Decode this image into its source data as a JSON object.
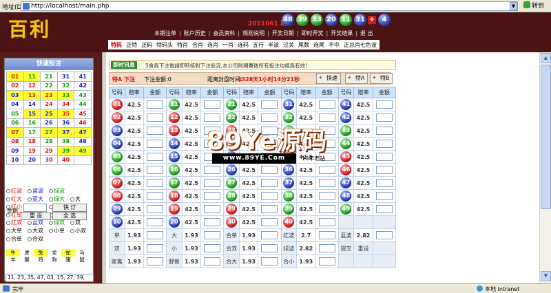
{
  "browser": {
    "address_label": "地址(D)",
    "url": "http://localhost/main.php",
    "dropdown_glyph": "▼",
    "go_label": "转到"
  },
  "header": {
    "logo": "百利",
    "period": "2011061 期",
    "balls": [
      {
        "n": "48",
        "color": "blue"
      },
      {
        "n": "39",
        "color": "green"
      },
      {
        "n": "33",
        "color": "green"
      },
      {
        "n": "20",
        "color": "blue"
      },
      {
        "n": "11",
        "color": "green"
      },
      {
        "n": "31",
        "color": "blue"
      }
    ],
    "plus": "+",
    "special": {
      "n": "4",
      "color": "blue"
    },
    "topnav": [
      "本期注单",
      "账户历史",
      "会员资料",
      "规则说明",
      "开奖日期",
      "即时开奖",
      "开奖结果",
      "退 出"
    ],
    "tabs": [
      "特码",
      "正特",
      "正码",
      "特码头",
      "特肖",
      "合肖",
      "连肖",
      "一肖",
      "连码",
      "五行",
      "半波",
      "过关",
      "尾数",
      "连尾",
      "不中",
      "正总肖七色波"
    ],
    "active_tab": 0
  },
  "left": {
    "title": "快速投注",
    "numbers": [
      [
        {
          "n": "01",
          "c": "r",
          "y": true
        },
        {
          "n": "11",
          "c": "g",
          "y": true
        },
        {
          "n": "21",
          "c": "g"
        },
        {
          "n": "31",
          "c": "b"
        },
        {
          "n": "41",
          "c": "b"
        }
      ],
      [
        {
          "n": "02",
          "c": "r"
        },
        {
          "n": "12",
          "c": "r"
        },
        {
          "n": "22",
          "c": "g"
        },
        {
          "n": "32",
          "c": "g"
        },
        {
          "n": "42",
          "c": "b"
        }
      ],
      [
        {
          "n": "03",
          "c": "b",
          "y": true
        },
        {
          "n": "13",
          "c": "r",
          "y": true
        },
        {
          "n": "23",
          "c": "r",
          "y": true
        },
        {
          "n": "33",
          "c": "g",
          "y": true
        },
        {
          "n": "43",
          "c": "g"
        }
      ],
      [
        {
          "n": "04",
          "c": "b"
        },
        {
          "n": "14",
          "c": "b"
        },
        {
          "n": "24",
          "c": "r"
        },
        {
          "n": "34",
          "c": "r"
        },
        {
          "n": "44",
          "c": "g"
        }
      ],
      [
        {
          "n": "05",
          "c": "g"
        },
        {
          "n": "15",
          "c": "b",
          "y": true
        },
        {
          "n": "25",
          "c": "b",
          "y": true
        },
        {
          "n": "35",
          "c": "r",
          "y": true
        },
        {
          "n": "45",
          "c": "r"
        }
      ],
      [
        {
          "n": "06",
          "c": "g"
        },
        {
          "n": "16",
          "c": "g"
        },
        {
          "n": "26",
          "c": "b"
        },
        {
          "n": "36",
          "c": "b"
        },
        {
          "n": "46",
          "c": "r"
        }
      ],
      [
        {
          "n": "07",
          "c": "r",
          "y": true
        },
        {
          "n": "17",
          "c": "g"
        },
        {
          "n": "27",
          "c": "g",
          "y": true
        },
        {
          "n": "37",
          "c": "b",
          "y": true
        },
        {
          "n": "47",
          "c": "b",
          "y": true
        }
      ],
      [
        {
          "n": "08",
          "c": "r"
        },
        {
          "n": "18",
          "c": "r"
        },
        {
          "n": "28",
          "c": "g"
        },
        {
          "n": "38",
          "c": "g"
        },
        {
          "n": "48",
          "c": "b"
        }
      ],
      [
        {
          "n": "09",
          "c": "b"
        },
        {
          "n": "19",
          "c": "r"
        },
        {
          "n": "29",
          "c": "r"
        },
        {
          "n": "39",
          "c": "g",
          "y": true
        },
        {
          "n": "49",
          "c": "g",
          "y": true
        }
      ],
      [
        {
          "n": "10",
          "c": "b"
        },
        {
          "n": "20",
          "c": "b"
        },
        {
          "n": "30",
          "c": "r"
        },
        {
          "n": "40",
          "c": "r"
        },
        {
          "n": "",
          "c": "b"
        }
      ]
    ],
    "options": [
      [
        "红波",
        "蓝波",
        "绿波"
      ],
      [
        "红大",
        "蓝大",
        "绿大",
        "大"
      ],
      [
        "红小",
        "蓝小",
        "绿小",
        "小"
      ],
      [
        "红单",
        "蓝单",
        "绿单",
        "单"
      ],
      [
        "红双",
        "蓝双",
        "绿双",
        "双"
      ],
      [
        "大单",
        "大双",
        "小单",
        "小双"
      ],
      [
        "合单",
        "合双"
      ]
    ],
    "zodiac_row1": [
      {
        "t": "牛",
        "y": true
      },
      {
        "t": "虎",
        "y": false
      },
      {
        "t": "兔",
        "y": true
      },
      {
        "t": "龙",
        "y": false
      },
      {
        "t": "蛇",
        "y": true
      },
      {
        "t": "马",
        "y": false
      }
    ],
    "zodiac_row2": [
      {
        "t": "羊",
        "y": false
      },
      {
        "t": "猴",
        "y": false
      },
      {
        "t": "鸡",
        "y": false
      },
      {
        "t": "狗",
        "y": false
      },
      {
        "t": "猪",
        "y": false
      },
      {
        "t": "鼠",
        "y": false
      }
    ],
    "amount_label": "金额",
    "btn_quick": "快 订",
    "btn_reset": "重 设",
    "btn_all": "全 选",
    "selected": "11, 23, 35, 47, 03, 15, 27, 39,"
  },
  "main": {
    "notice_label": "即时讯息",
    "notice_text": "5會員下注後請即時核對下注狀況,本公司則開賽後所有投注均視爲有效!",
    "bet_type": "特A 下注",
    "bet_total": "下注金额:0",
    "close_label": "距离封盘时间:",
    "close_time": "4328天1小时14分21秒",
    "btn_quick": "快速",
    "btn_a": "特A",
    "btn_b": "特B",
    "headers": [
      "号码",
      "赔率",
      "金额",
      "号码",
      "赔率",
      "金额",
      "号码",
      "赔率",
      "金额",
      "号码",
      "赔率",
      "金额",
      "号码",
      "赔率",
      "金额"
    ],
    "odds": "42.5",
    "rows": [
      [
        {
          "n": "01",
          "c": "red"
        },
        {
          "n": "11",
          "c": "green"
        },
        {
          "n": "21",
          "c": "green"
        },
        {
          "n": "31",
          "c": "blue"
        },
        {
          "n": "41",
          "c": "blue"
        }
      ],
      [
        {
          "n": "02",
          "c": "red"
        },
        {
          "n": "12",
          "c": "red"
        },
        {
          "n": "22",
          "c": "green"
        },
        {
          "n": "32",
          "c": "green"
        },
        {
          "n": "42",
          "c": "blue"
        }
      ],
      [
        {
          "n": "03",
          "c": "blue"
        },
        {
          "n": "13",
          "c": "red"
        },
        {
          "n": "23",
          "c": "red"
        },
        {
          "n": "33",
          "c": "green"
        },
        {
          "n": "43",
          "c": "green"
        }
      ],
      [
        {
          "n": "04",
          "c": "blue"
        },
        {
          "n": "14",
          "c": "blue"
        },
        {
          "n": "24",
          "c": "red"
        },
        {
          "n": "34",
          "c": "red"
        },
        {
          "n": "44",
          "c": "green"
        }
      ],
      [
        {
          "n": "05",
          "c": "green"
        },
        {
          "n": "15",
          "c": "blue"
        },
        {
          "n": "25",
          "c": "blue"
        },
        {
          "n": "35",
          "c": "red"
        },
        {
          "n": "45",
          "c": "red"
        }
      ],
      [
        {
          "n": "06",
          "c": "green"
        },
        {
          "n": "16",
          "c": "green"
        },
        {
          "n": "26",
          "c": "blue"
        },
        {
          "n": "36",
          "c": "blue"
        },
        {
          "n": "46",
          "c": "red"
        }
      ],
      [
        {
          "n": "07",
          "c": "red"
        },
        {
          "n": "17",
          "c": "green"
        },
        {
          "n": "27",
          "c": "green"
        },
        {
          "n": "37",
          "c": "blue"
        },
        {
          "n": "47",
          "c": "blue"
        }
      ],
      [
        {
          "n": "08",
          "c": "red"
        },
        {
          "n": "18",
          "c": "red"
        },
        {
          "n": "28",
          "c": "green"
        },
        {
          "n": "38",
          "c": "green"
        },
        {
          "n": "48",
          "c": "blue"
        }
      ],
      [
        {
          "n": "09",
          "c": "blue"
        },
        {
          "n": "19",
          "c": "red"
        },
        {
          "n": "29",
          "c": "red"
        },
        {
          "n": "39",
          "c": "green"
        },
        {
          "n": "49",
          "c": "green"
        }
      ],
      [
        {
          "n": "10",
          "c": "blue"
        },
        {
          "n": "20",
          "c": "blue"
        },
        {
          "n": "30",
          "c": "red"
        },
        {
          "n": "40",
          "c": "red"
        }
      ]
    ],
    "bottom_rows": [
      [
        {
          "l": "单",
          "v": "1.93"
        },
        {
          "l": "大",
          "v": "1.93"
        },
        {
          "l": "合单",
          "v": "1.93"
        },
        {
          "l": "红波",
          "v": "2.7"
        },
        {
          "l": "蓝波",
          "v": "2.82"
        }
      ],
      [
        {
          "l": "双",
          "v": "1.93"
        },
        {
          "l": "小",
          "v": "1.93"
        },
        {
          "l": "合双",
          "v": "1.93"
        },
        {
          "l": "绿波",
          "v": "2.82"
        },
        {
          "l": "提交",
          "v": "",
          "btn": true
        },
        {
          "l": "重设",
          "v": "",
          "btn": true
        }
      ],
      [
        {
          "l": "家禽",
          "v": "1.93"
        },
        {
          "l": "野兽",
          "v": "1.93"
        },
        {
          "l": "合大",
          "v": "1.93"
        },
        {
          "l": "合小",
          "v": "1.93"
        }
      ]
    ]
  },
  "watermark": {
    "main": "89Ye源码",
    "sub": "www.89YE.Com",
    "tag": "10年老站"
  },
  "status": {
    "text": "完毕",
    "zone": "本地 Intranet"
  },
  "scroll": {
    "up_glyph": "▲",
    "down_glyph": "▼"
  }
}
